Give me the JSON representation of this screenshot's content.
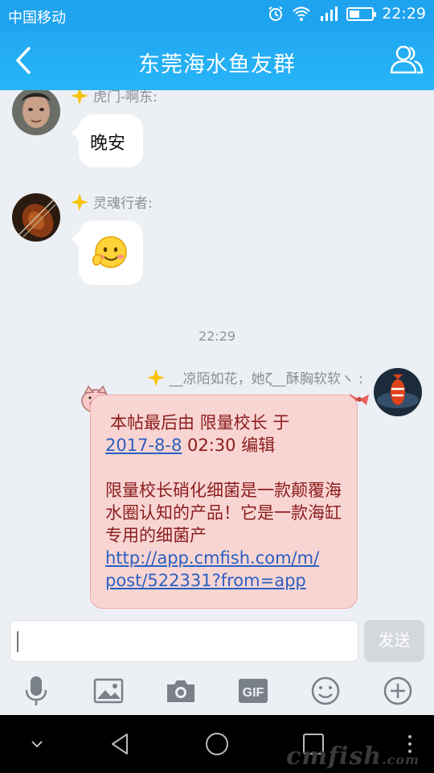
{
  "status_bar": {
    "carrier": "中国移动",
    "time": "22:29",
    "battery_level": 0.45
  },
  "header": {
    "title": "东莞海水鱼友群",
    "back_icon": "chevron-left-icon",
    "members_icon": "group-members-icon"
  },
  "messages": [
    {
      "sender": "虎门-啊东:",
      "text": "晚安",
      "avatar_icon": "person-photo-avatar"
    },
    {
      "sender": "灵魂行者:",
      "emoji": "blushing-smile-emoji",
      "avatar_icon": "violin-photo-avatar"
    }
  ],
  "timestamp": "22:29",
  "own_message": {
    "sender": "__凉陌如花，她ζ__酥胸软软ヽ :",
    "line1": "本帖最后由 限量校长 于",
    "date_link": "2017-8-8",
    "line2_rest": " 02:30 编辑",
    "body": "限量校长硝化细菌是一款颠覆海水圈认知的产品！它是一款海缸专用的细菌产",
    "url_line1": "http://app.cmfish.com/m/",
    "url_line2": "post/522331?from=app",
    "avatar_icon": "clownfish-photo-avatar",
    "bubble_color": "#f8d5d3"
  },
  "composer": {
    "input_value": "",
    "send_label": "发送"
  },
  "toolbar": [
    "microphone-icon",
    "image-icon",
    "camera-icon",
    "gif-icon",
    "emoji-icon",
    "plus-icon"
  ],
  "toolbar_gif_label": "GIF",
  "watermark": {
    "main": "cmfish",
    "suffix": ".com"
  },
  "colors": {
    "accent": "#1ea3ef",
    "background": "#eceff3"
  }
}
